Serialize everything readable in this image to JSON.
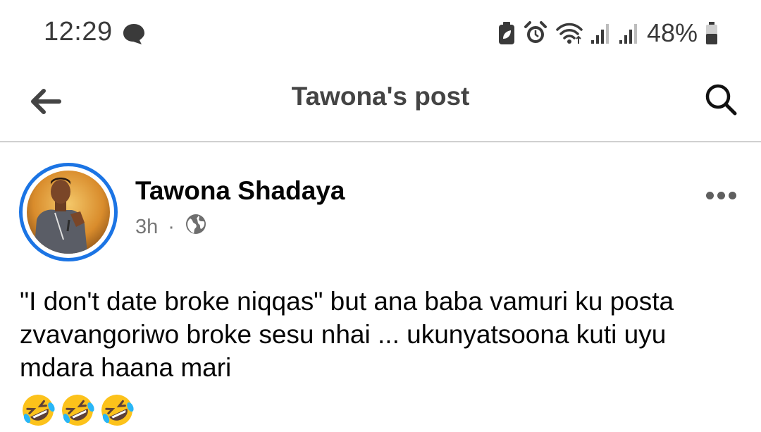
{
  "status_bar": {
    "time": "12:29",
    "battery_percent": "48%",
    "icons": [
      "message-bubble-icon",
      "battery-saver-icon",
      "alarm-icon",
      "wifi-icon",
      "signal-1-icon",
      "signal-2-icon",
      "battery-icon"
    ]
  },
  "app_bar": {
    "title": "Tawona's post",
    "back_icon": "arrow-left-icon",
    "search_icon": "search-icon"
  },
  "post": {
    "author": "Tawona Shadaya",
    "time": "3h",
    "separator": "·",
    "privacy_icon": "globe-icon",
    "more_icon": "more-horizontal-icon",
    "text": "\"I don't date broke niqqas\" but ana baba vamuri ku posta zvavangoriwo broke sesu nhai ... ukunyatsoona kuti uyu mdara haana mari",
    "emojis": [
      "rolling-on-floor-laughing",
      "rolling-on-floor-laughing",
      "rolling-on-floor-laughing"
    ]
  },
  "colors": {
    "accent_ring": "#1b74e4",
    "text_primary": "#050505",
    "text_secondary": "#777777",
    "divider": "#d0d0d0"
  }
}
